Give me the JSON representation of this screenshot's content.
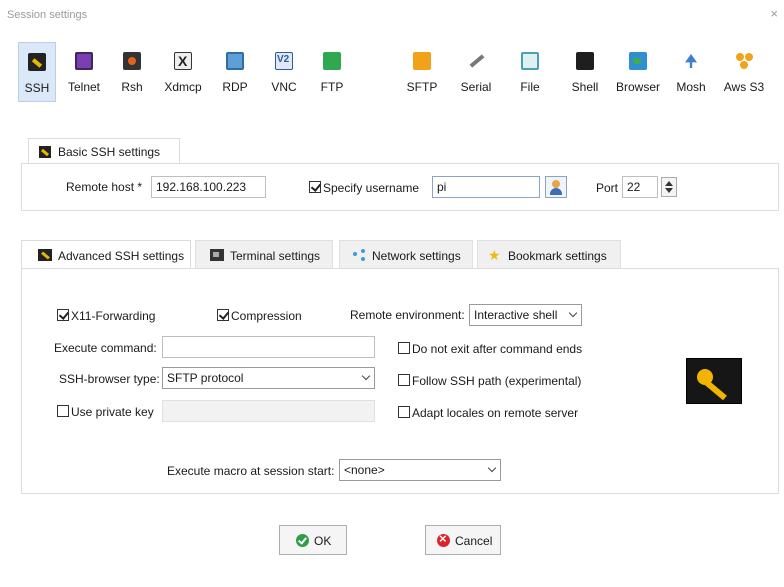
{
  "window": {
    "title": "Session settings",
    "close_glyph": "×"
  },
  "protocols": [
    {
      "label": "SSH",
      "icon": "ssh-icon",
      "selected": true
    },
    {
      "label": "Telnet",
      "icon": "telnet-icon"
    },
    {
      "label": "Rsh",
      "icon": "rsh-icon"
    },
    {
      "label": "Xdmcp",
      "icon": "xdmcp-icon"
    },
    {
      "label": "RDP",
      "icon": "rdp-icon"
    },
    {
      "label": "VNC",
      "icon": "vnc-icon"
    },
    {
      "label": "FTP",
      "icon": "ftp-icon"
    },
    {
      "label": "SFTP",
      "icon": "sftp-icon"
    },
    {
      "label": "Serial",
      "icon": "serial-icon"
    },
    {
      "label": "File",
      "icon": "file-icon"
    },
    {
      "label": "Shell",
      "icon": "shell-icon"
    },
    {
      "label": "Browser",
      "icon": "browser-icon"
    },
    {
      "label": "Mosh",
      "icon": "mosh-icon"
    },
    {
      "label": "Aws S3",
      "icon": "aws-s3-icon"
    }
  ],
  "basic": {
    "tab_label": "Basic SSH settings",
    "remote_host_label": "Remote host *",
    "remote_host_value": "192.168.100.223",
    "specify_username_label": "Specify username",
    "specify_username_checked": true,
    "username_value": "pi",
    "port_label": "Port",
    "port_value": "22"
  },
  "advanced_tabs": [
    {
      "label": "Advanced SSH settings",
      "icon": "key-icon",
      "active": true
    },
    {
      "label": "Terminal settings",
      "icon": "terminal-icon"
    },
    {
      "label": "Network settings",
      "icon": "network-icon"
    },
    {
      "label": "Bookmark settings",
      "icon": "star-icon"
    }
  ],
  "advanced": {
    "x11_label": "X11-Forwarding",
    "x11_checked": true,
    "compression_label": "Compression",
    "compression_checked": true,
    "remote_env_label": "Remote environment:",
    "remote_env_value": "Interactive shell",
    "execute_command_label": "Execute command:",
    "execute_command_value": "",
    "do_not_exit_label": "Do not exit after command ends",
    "ssh_browser_label": "SSH-browser type:",
    "ssh_browser_value": "SFTP protocol",
    "follow_path_label": "Follow SSH path (experimental)",
    "use_private_key_label": "Use private key",
    "private_key_value": "",
    "adapt_locales_label": "Adapt locales on remote server",
    "macro_label": "Execute macro at session start:",
    "macro_value": "<none>"
  },
  "buttons": {
    "ok_label": "OK",
    "cancel_label": "Cancel"
  },
  "colors": {
    "selected_bg": "#dbe8f7",
    "ok_green": "#2e9e46",
    "cancel_red": "#d8262a",
    "key_yellow": "#f2b400"
  }
}
